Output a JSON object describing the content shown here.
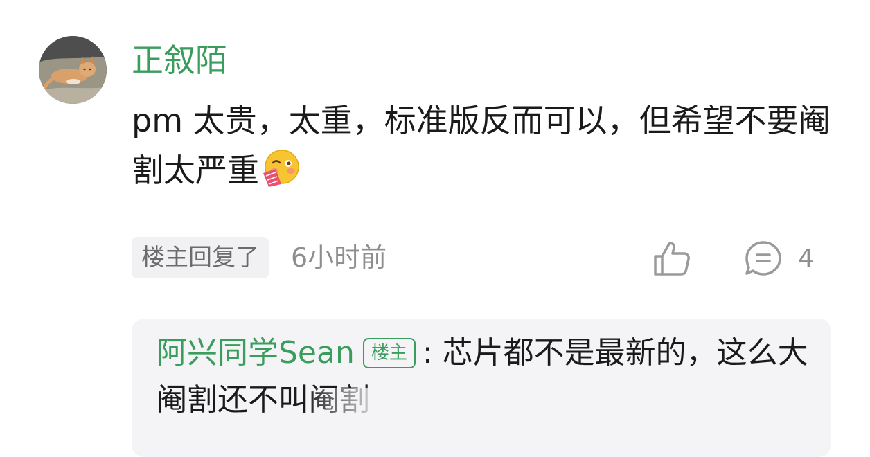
{
  "comment": {
    "username": "正叙陌",
    "text": "pm 太贵，太重，标准版反而可以，但希望不要阉割太严重",
    "emoji": "blushing-face-emoji",
    "op_tag": "楼主回复了",
    "time": "6小时前",
    "reply_count": "4"
  },
  "reply": {
    "author": "阿兴同学Sean",
    "badge": "楼主",
    "text": ": 芯片都不是最新的，这么大阉割还不叫阉割"
  },
  "colors": {
    "accent": "#3a9d5d",
    "text": "#1a1a1a",
    "muted": "#8e8e8e",
    "reply_bg": "#f4f4f6"
  }
}
